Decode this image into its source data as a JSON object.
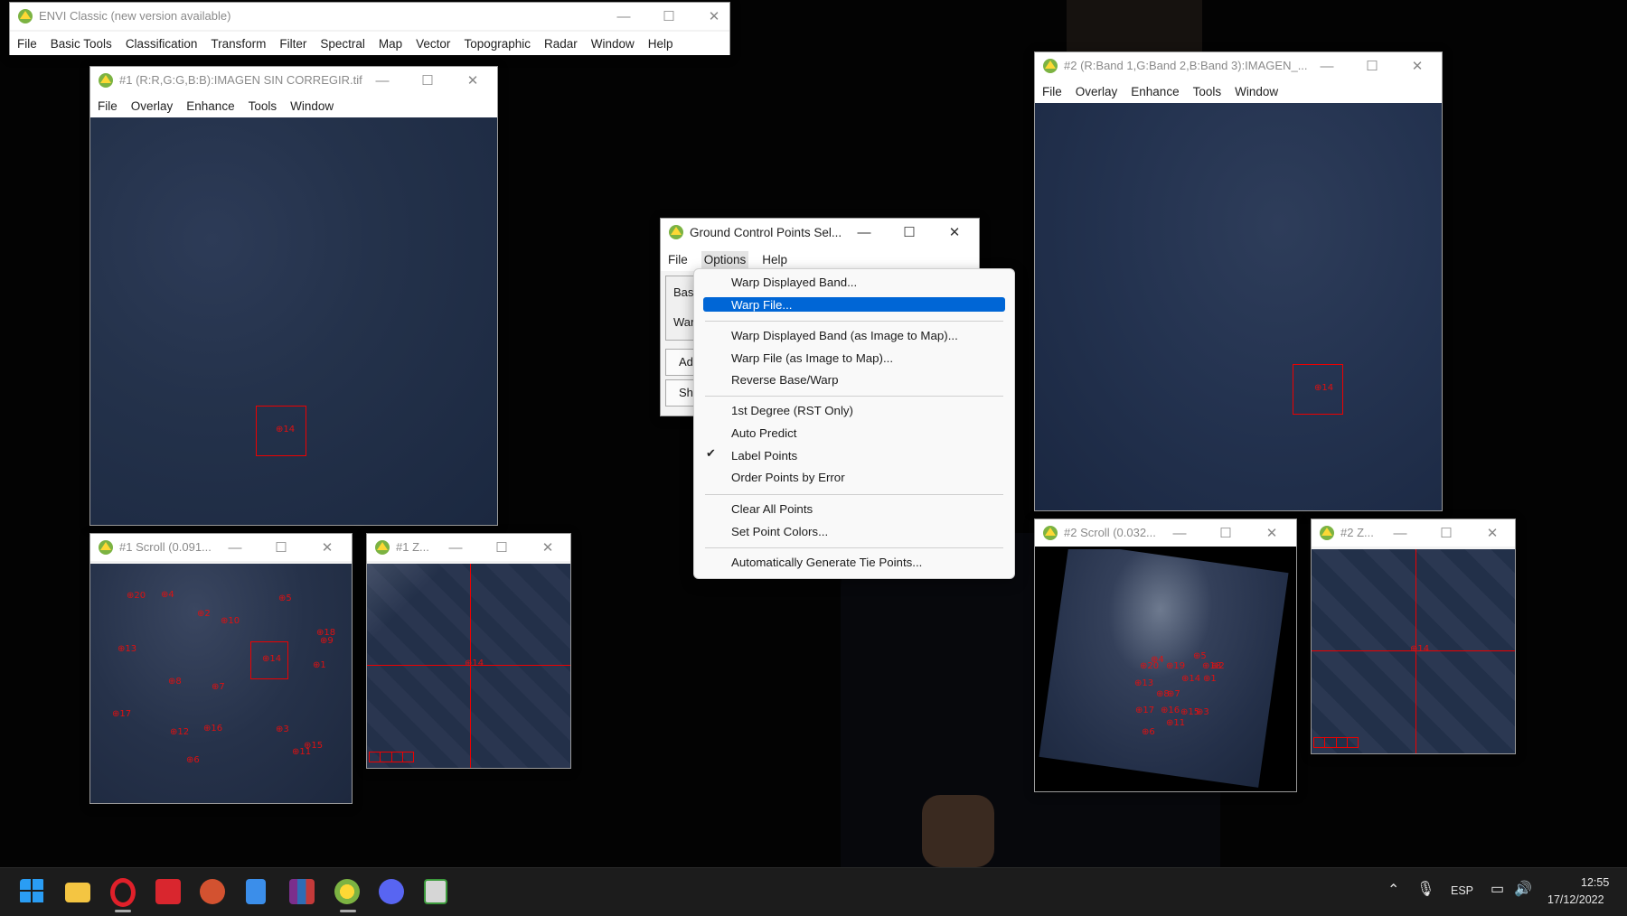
{
  "main_window": {
    "title": "ENVI Classic (new version available)",
    "menu": [
      "File",
      "Basic Tools",
      "Classification",
      "Transform",
      "Filter",
      "Spectral",
      "Map",
      "Vector",
      "Topographic",
      "Radar",
      "Window",
      "Help"
    ]
  },
  "display1": {
    "title": "#1 (R:R,G:G,B:B):IMAGEN SIN CORREGIR.tif",
    "menu": [
      "File",
      "Overlay",
      "Enhance",
      "Tools",
      "Window"
    ],
    "point_label": "14"
  },
  "display2": {
    "title": "#2 (R:Band 1,G:Band 2,B:Band 3):IMAGEN_...",
    "menu": [
      "File",
      "Overlay",
      "Enhance",
      "Tools",
      "Window"
    ],
    "point_label": "14"
  },
  "scroll1": {
    "title": "#1 Scroll (0.091...",
    "points": [
      "20",
      "4",
      "5",
      "2",
      "10",
      "18",
      "9",
      "13",
      "14",
      "1",
      "8",
      "7",
      "17",
      "12",
      "16",
      "3",
      "15",
      "11",
      "6"
    ]
  },
  "zoom1": {
    "title": "#1 Z...",
    "point_label": "14"
  },
  "scroll2": {
    "title": "#2 Scroll (0.032...",
    "points": [
      "5",
      "4",
      "20",
      "19",
      "18",
      "2",
      "14",
      "1",
      "13",
      "8",
      "7",
      "17",
      "16",
      "15",
      "3",
      "11",
      "6"
    ]
  },
  "zoom2": {
    "title": "#2 Z...",
    "point_label": "14"
  },
  "gcp_dialog": {
    "title": "Ground Control Points Sel...",
    "menu": [
      "File",
      "Options",
      "Help"
    ],
    "partial_labels": [
      "Base",
      "War",
      "Add",
      "Sho"
    ]
  },
  "options_menu": {
    "items": [
      {
        "label": "Warp Displayed Band...",
        "highlighted": false,
        "checked": false
      },
      {
        "label": "Warp File...",
        "highlighted": true,
        "checked": false
      },
      {
        "label": "Warp Displayed Band (as Image to Map)...",
        "highlighted": false,
        "checked": false
      },
      {
        "label": "Warp File (as Image to Map)...",
        "highlighted": false,
        "checked": false
      },
      {
        "label": "Reverse Base/Warp",
        "highlighted": false,
        "checked": false
      },
      {
        "label": "1st Degree (RST Only)",
        "highlighted": false,
        "checked": false
      },
      {
        "label": "Auto Predict",
        "highlighted": false,
        "checked": false
      },
      {
        "label": "Label Points",
        "highlighted": false,
        "checked": true
      },
      {
        "label": "Order Points by Error",
        "highlighted": false,
        "checked": false
      },
      {
        "label": "Clear All Points",
        "highlighted": false,
        "checked": false
      },
      {
        "label": "Set Point Colors...",
        "highlighted": false,
        "checked": false
      },
      {
        "label": "Automatically Generate Tie Points...",
        "highlighted": false,
        "checked": false
      }
    ],
    "highlight_color": "#0066d6"
  },
  "window_controls": {
    "minimize": "—",
    "maximize": "☐",
    "close": "✕"
  },
  "taskbar": {
    "apps": [
      "start-icon",
      "file-explorer-icon",
      "opera-icon",
      "acrobat-icon",
      "powerpoint-icon",
      "notepad-icon",
      "winrar-icon",
      "envi-icon",
      "discord-icon",
      "script-editor-icon"
    ],
    "language": "ESP",
    "time": "12:55",
    "date": "17/12/2022"
  },
  "colors": {
    "gcp_red": "#e01010",
    "image_blue": "#223049",
    "taskbar": "#1c1c1c"
  }
}
